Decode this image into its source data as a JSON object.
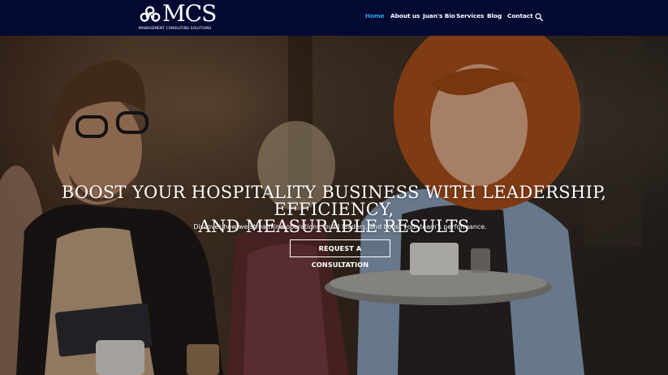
{
  "brand": {
    "logo_text": "MCS",
    "logo_subtitle": "MANAGEMENT CONSULTING SOLUTIONS"
  },
  "nav": {
    "items": [
      {
        "label": "Home",
        "active": true
      },
      {
        "label": "About us",
        "active": false
      },
      {
        "label": "Juan's Bio",
        "active": false
      },
      {
        "label": "Services",
        "active": false
      },
      {
        "label": "Blog",
        "active": false
      },
      {
        "label": "Contact",
        "active": false
      }
    ],
    "search_icon": "search-icon"
  },
  "hero": {
    "title_line1": "BOOST YOUR HOSPITALITY BUSINESS WITH LEADERSHIP, EFFICIENCY,",
    "title_line2": "AND MEASURABLE RESULTS",
    "subtitle": "Discover how we streamline operations, build leaders, and boost your team's performance.",
    "cta_label": "REQUEST A CONSULTATION"
  },
  "colors": {
    "header_bg": "#050a33",
    "active_link": "#2ea3f2",
    "text": "#ffffff"
  }
}
